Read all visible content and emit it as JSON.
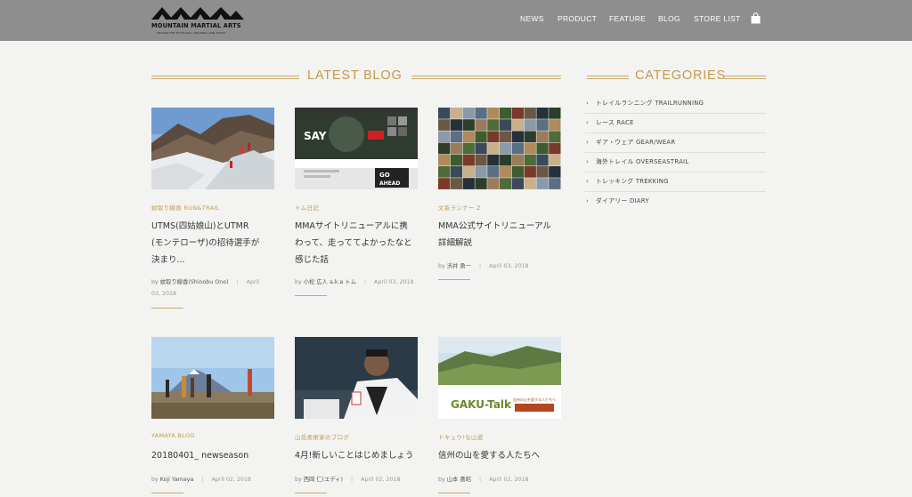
{
  "header": {
    "logo_text": "MOUNTAIN MARTIAL ARTS",
    "logo_tagline": "DESIGN FOR OUTDOOR, TRAINING AND SPORT",
    "nav": [
      "NEWS",
      "PRODUCT",
      "FEATURE",
      "BLOG",
      "STORE LIST"
    ],
    "cart_icon": "shopping-bag-icon"
  },
  "latest_blog": {
    "heading": "LATEST BLOG",
    "posts": [
      {
        "category": "蚊取り線香 RUN&TRAIL",
        "title_lines": [
          "UTMS(四姑娘山)とUTMR",
          "(モンテローザ)の招待選手が",
          "決まり..."
        ],
        "by": "by",
        "author": "蚊取り線香(Shinobu Ono)",
        "date_lines": [
          "April",
          "03, 2018"
        ]
      },
      {
        "category": "トム日記",
        "title_lines": [
          "MMAサイトリニューアルに携",
          "わって、走っててよかったなと",
          "感じた話"
        ],
        "by": "by",
        "author": "小松 広人 a.k.a トム",
        "date_lines": [
          "April 03, 2018"
        ]
      },
      {
        "category": "文系ランナー Z",
        "title_lines": [
          "MMA公式サイトリニューアル",
          "詳細解説"
        ],
        "by": "by",
        "author": "渋井 勇一",
        "date_lines": [
          "April 03, 2018"
        ]
      },
      {
        "category": "YAMAYA BLOG",
        "title_lines": [
          "20180401_ newseason"
        ],
        "by": "by",
        "author": "Koji Yamaya",
        "date_lines": [
          "April 02, 2018"
        ]
      },
      {
        "category": "山岳柔術家のブログ",
        "title_lines": [
          "4月!新しいことはじめましょう"
        ],
        "by": "by",
        "author": "西岡 仁(エディ)",
        "date_lines": [
          "April 02, 2018"
        ]
      },
      {
        "category": "ドキュウ!な山道",
        "title_lines": [
          "信州の山を愛する人たちへ"
        ],
        "by": "by",
        "author": "山本 喜昭",
        "date_lines": [
          "April 02, 2018"
        ]
      }
    ],
    "thumb2_texts": [
      "SAY",
      "GO",
      "AHEAD"
    ],
    "thumb6_text": "GAKU-Talk",
    "thumb6_subtext": "信州の山を愛する人たちへ"
  },
  "categories": {
    "heading": "CATEGORIES",
    "items": [
      "トレイルランニング TRAILRUNNING",
      "レース RACE",
      "ギア・ウェア GEAR/WEAR",
      "海外トレイル OVERSEASTRAIL",
      "トレッキング TREKKING",
      "ダイアリー DIARY"
    ]
  },
  "colors": {
    "accent": "#c29a4f",
    "header_bg": "#8e8e8e",
    "page_bg": "#f3f3f1"
  }
}
